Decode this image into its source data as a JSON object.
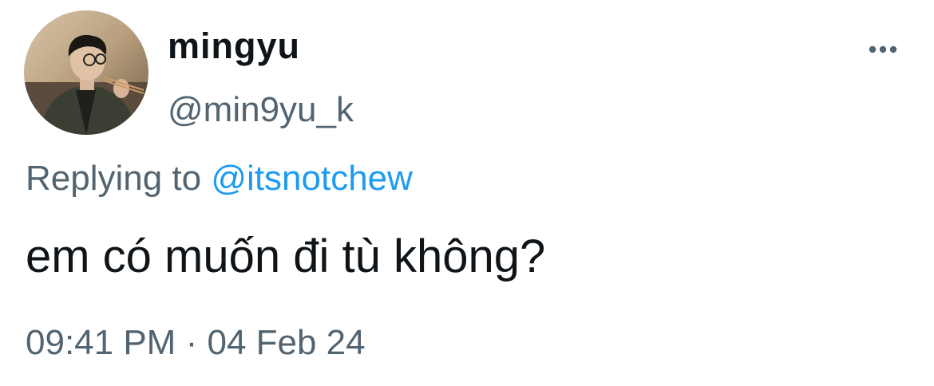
{
  "author": {
    "display_name": "mingyu",
    "handle": "@min9yu_k",
    "avatar": "profile-photo"
  },
  "reply": {
    "prefix": "Replying to",
    "target": "@itsnotchew",
    "link_color": "#1d9bf0"
  },
  "tweet": {
    "text": "em có muốn đi tù không?"
  },
  "meta": {
    "time": "09:41 PM",
    "separator": "·",
    "date": "04 Feb 24"
  },
  "icons": {
    "more": "more-horizontal-icon"
  },
  "colors": {
    "text_primary": "#0f1419",
    "text_secondary": "#536471",
    "accent": "#1d9bf0"
  }
}
